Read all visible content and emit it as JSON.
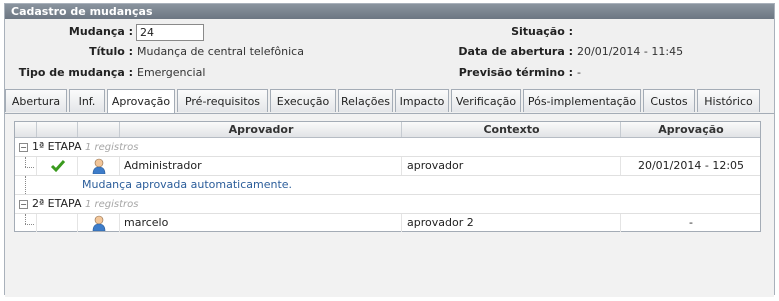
{
  "window": {
    "title": "Cadastro de mudanças"
  },
  "form": {
    "mudanca_label": "Mudança :",
    "mudanca_value": "24",
    "titulo_label": "Título :",
    "titulo_value": "Mudança de central telefônica",
    "tipo_label": "Tipo de mudança :",
    "tipo_value": "Emergencial",
    "situacao_label": "Situação :",
    "situacao_value": "",
    "abertura_label": "Data de abertura :",
    "abertura_value": "20/01/2014 - 11:45",
    "previsao_label": "Previsão término :",
    "previsao_value": "-"
  },
  "tabs": [
    {
      "label": "Abertura"
    },
    {
      "label": "Inf."
    },
    {
      "label": "Aprovação"
    },
    {
      "label": "Pré-requisitos"
    },
    {
      "label": "Execução"
    },
    {
      "label": "Relações"
    },
    {
      "label": "Impacto"
    },
    {
      "label": "Verificação"
    },
    {
      "label": "Pós-implementação"
    },
    {
      "label": "Custos"
    },
    {
      "label": "Histórico"
    }
  ],
  "active_tab": "Aprovação",
  "grid": {
    "headers": [
      "Aprovador",
      "Contexto",
      "Aprovação"
    ],
    "groups": [
      {
        "name": "1ª ETAPA",
        "count": "1 registros",
        "rows": [
          {
            "approver": "Administrador",
            "context": "aprovador",
            "approval": "20/01/2014 - 12:05",
            "status_icon": "check-icon"
          }
        ],
        "note": "Mudança aprovada automaticamente."
      },
      {
        "name": "2ª ETAPA",
        "count": "1 registros",
        "rows": [
          {
            "approver": "marcelo",
            "context": "aprovador 2",
            "approval": "-",
            "status_icon": ""
          }
        ]
      }
    ]
  },
  "colors": {
    "titlebar": "#7a848f",
    "check": "#3a9a1e",
    "note": "#2b5d9a"
  }
}
